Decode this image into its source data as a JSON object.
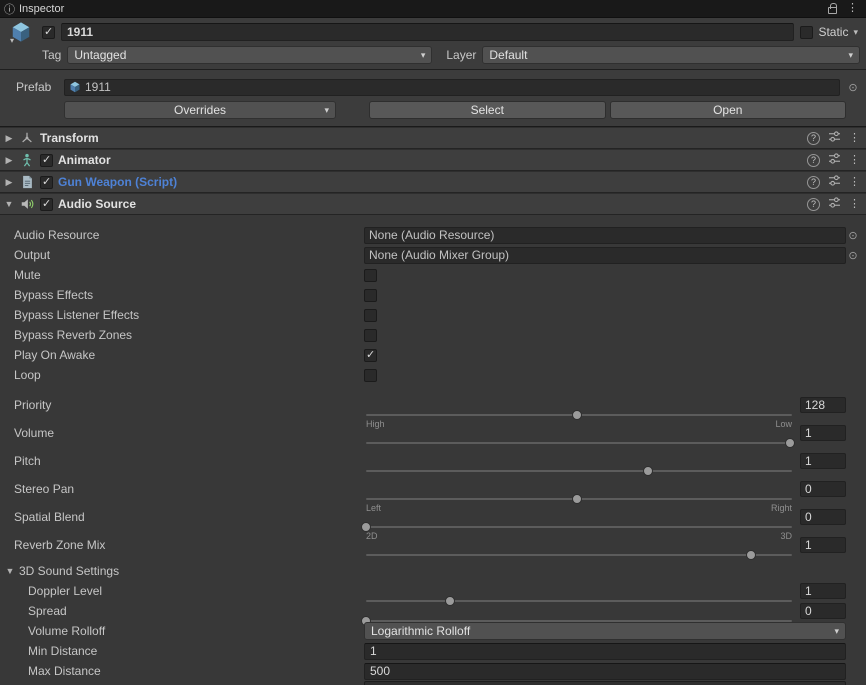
{
  "colors": {
    "window_bg": "#383838",
    "field_bg": "#2a2a2a",
    "script_link": "#4e82d6"
  },
  "icons": {
    "info": "ⓘ",
    "fold_open": "▼",
    "fold_closed": "▶",
    "dropdown_arrow": "▾",
    "kebab": "⋮",
    "help": "?",
    "picker": "⊙"
  },
  "tab": {
    "title": "Inspector"
  },
  "header": {
    "active": true,
    "name_value": "1911",
    "static_label": "Static",
    "static_checked": false,
    "tag_label": "Tag",
    "tag_value": "Untagged",
    "layer_label": "Layer",
    "layer_value": "Default",
    "prefab_label": "Prefab",
    "prefab_name": "1911",
    "overrides_label": "Overrides",
    "select_label": "Select",
    "open_label": "Open"
  },
  "components": {
    "transform": {
      "title": "Transform"
    },
    "animator": {
      "title": "Animator",
      "enabled": true
    },
    "script": {
      "title": "Gun Weapon (Script)",
      "enabled": true
    },
    "audio": {
      "title": "Audio Source",
      "enabled": true
    }
  },
  "audio": {
    "audio_resource": {
      "label": "Audio Resource",
      "value": "None (Audio Resource)"
    },
    "output": {
      "label": "Output",
      "value": "None (Audio Mixer Group)"
    },
    "toggles": [
      {
        "label": "Mute",
        "checked": false
      },
      {
        "label": "Bypass Effects",
        "checked": false
      },
      {
        "label": "Bypass Listener Effects",
        "checked": false
      },
      {
        "label": "Bypass Reverb Zones",
        "checked": false
      },
      {
        "label": "Play On Awake",
        "checked": true
      },
      {
        "label": "Loop",
        "checked": false
      }
    ],
    "sliders": [
      {
        "label": "Priority",
        "value": "128",
        "pos": 49.5,
        "sub_left": "High",
        "sub_right": "Low"
      },
      {
        "label": "Volume",
        "value": "1",
        "pos": 99
      },
      {
        "label": "Pitch",
        "value": "1",
        "pos": 66
      },
      {
        "label": "Stereo Pan",
        "value": "0",
        "pos": 49.5,
        "sub_left": "Left",
        "sub_right": "Right"
      },
      {
        "label": "Spatial Blend",
        "value": "0",
        "pos": 0.5,
        "sub_left": "2D",
        "sub_right": "3D"
      },
      {
        "label": "Reverb Zone Mix",
        "value": "1",
        "pos": 90
      }
    ],
    "sound3d": {
      "title": "3D Sound Settings",
      "sliders": [
        {
          "label": "Doppler Level",
          "value": "1",
          "pos": 20
        },
        {
          "label": "Spread",
          "value": "0",
          "pos": 0.5
        }
      ],
      "volume_rolloff": {
        "label": "Volume Rolloff",
        "value": "Logarithmic Rolloff"
      },
      "min_distance": {
        "label": "Min Distance",
        "value": "1"
      },
      "max_distance": {
        "label": "Max Distance",
        "value": "500"
      }
    }
  }
}
